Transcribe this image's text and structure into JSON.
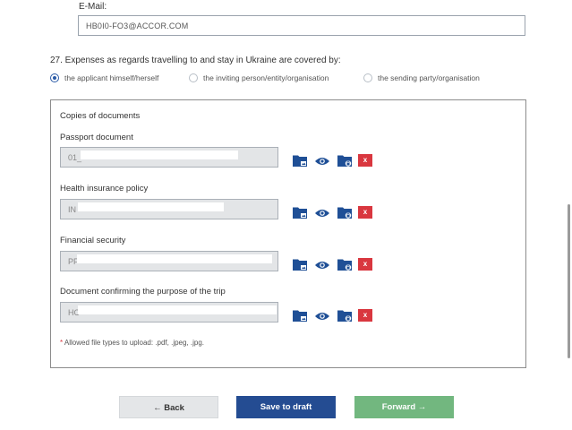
{
  "email": {
    "label": "E-Mail:",
    "value": "HB0I0-FO3@ACCOR.COM"
  },
  "expenses": {
    "question": "27. Expenses as regards travelling to and stay in Ukraine are covered by:",
    "options": [
      {
        "label": "the applicant himself/herself",
        "checked": true
      },
      {
        "label": "the inviting person/entity/organisation",
        "checked": false
      },
      {
        "label": "the sending party/organisation",
        "checked": false
      }
    ]
  },
  "documents": {
    "title": "Copies of documents",
    "items": [
      {
        "label": "Passport document",
        "value": "01_"
      },
      {
        "label": "Health insurance policy",
        "value": "IN"
      },
      {
        "label": "Financial security",
        "value": "PF"
      },
      {
        "label": "Document confirming the purpose of the trip",
        "value": "HC"
      }
    ],
    "delete_label": "x",
    "icons": [
      "folder-image-icon",
      "eye-icon",
      "folder-lock-icon",
      "delete-icon"
    ],
    "hint_star": "*",
    "hint": "Allowed file types to upload: .pdf, .jpeg, .jpg."
  },
  "buttons": {
    "back": "← Back",
    "draft": "Save to draft",
    "forward": "Forward →"
  },
  "colors": {
    "primary": "#244c92",
    "forward": "#72b77f",
    "delete": "#d9373f",
    "icon": "#1f4f96"
  }
}
